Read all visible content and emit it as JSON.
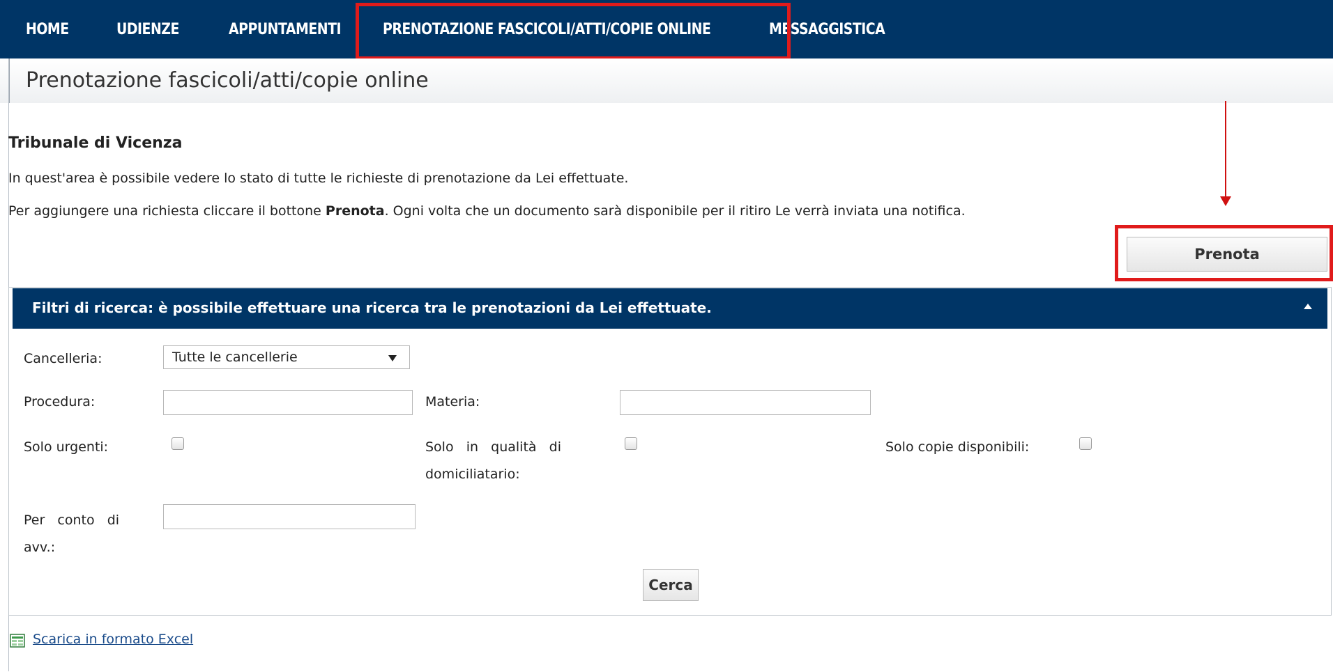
{
  "nav": {
    "items": [
      "HOME",
      "UDIENZE",
      "APPUNTAMENTI",
      "PRENOTAZIONE FASCICOLI/ATTI/COPIE ONLINE",
      "MESSAGGISTICA"
    ]
  },
  "page": {
    "title": "Prenotazione fascicoli/atti/copie online",
    "section_title": "Tribunale di Vicenza",
    "intro": "In quest'area è possibile vedere lo stato di tutte le richieste di prenotazione da Lei effettuate.",
    "instructions_before": "Per aggiungere una richiesta cliccare il bottone ",
    "instructions_bold": "Prenota",
    "instructions_after": ". Ogni volta che un documento sarà disponibile per il ritiro Le verrà inviata una notifica."
  },
  "prenota_button": "Prenota",
  "filters": {
    "title": "Filtri di ricerca: è possibile effettuare una ricerca tra le prenotazioni da Lei effettuate.",
    "cancelleria_label": "Cancelleria:",
    "cancelleria_value": "Tutte le cancellerie",
    "procedura_label": "Procedura:",
    "procedura_value": "",
    "materia_label": "Materia:",
    "materia_value": "",
    "urgenti_label": "Solo urgenti:",
    "domiciliatario_label_1": "Solo   in   qualità   di",
    "domiciliatario_label_2": "domiciliatario:",
    "copie_label": "Solo copie disponibili:",
    "per_conto_label_1": "Per   conto   di",
    "per_conto_label_2": "avv.:",
    "per_conto_value": "",
    "cerca_button": "Cerca"
  },
  "download_link": "Scarica in formato Excel",
  "colors": {
    "nav_bg": "#003566",
    "highlight": "#e01b1b",
    "arrow": "#d01010"
  }
}
